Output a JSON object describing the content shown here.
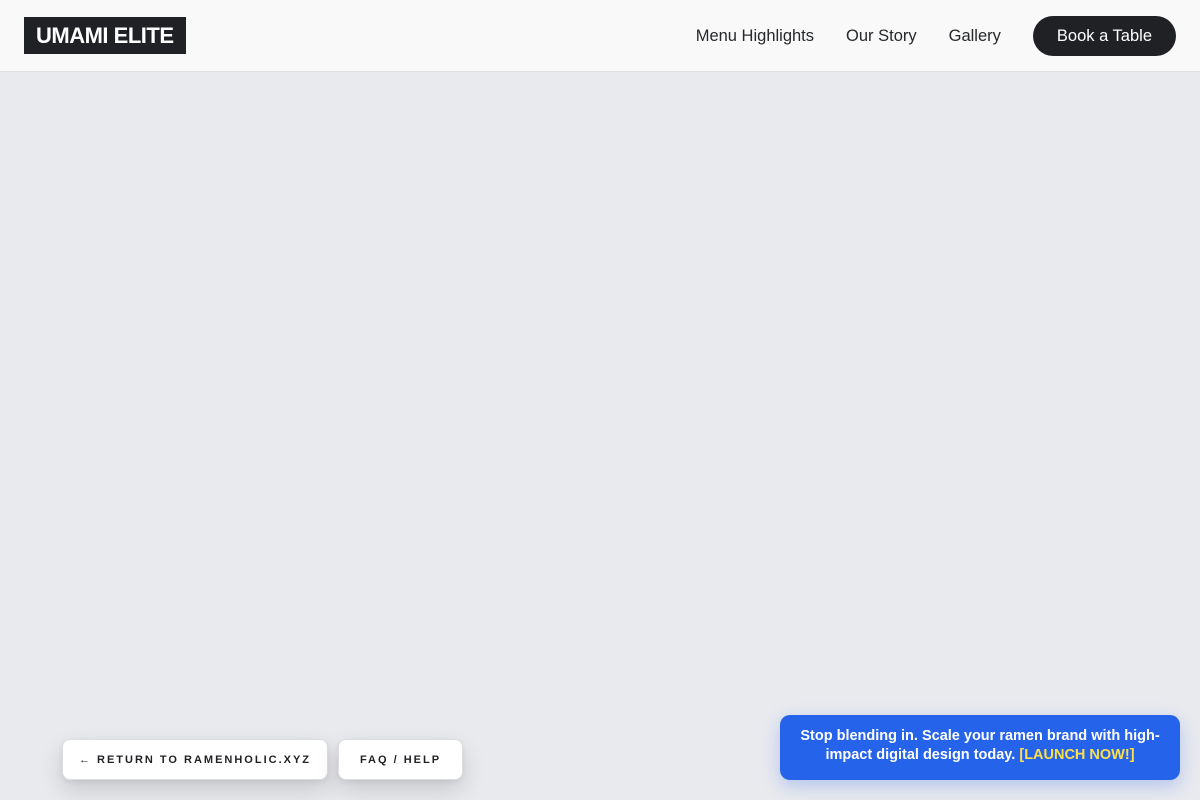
{
  "header": {
    "logo": "UMAMI ELITE",
    "nav": {
      "menu_highlights": "Menu Highlights",
      "our_story": "Our Story",
      "gallery": "Gallery"
    },
    "cta": "Book a Table"
  },
  "footer_buttons": {
    "return": "← RETURN TO RAMENHOLIC.XYZ",
    "faq": "FAQ / HELP"
  },
  "promo": {
    "text": "Stop blending in. Scale your ramen brand with high-impact digital design today.",
    "cta": "[LAUNCH NOW!]"
  },
  "colors": {
    "background": "#e9eaee",
    "header_bg": "#f9f9f9",
    "dark": "#1f2125",
    "promo_blue": "#2563eb",
    "promo_cta_yellow": "#fde047"
  }
}
